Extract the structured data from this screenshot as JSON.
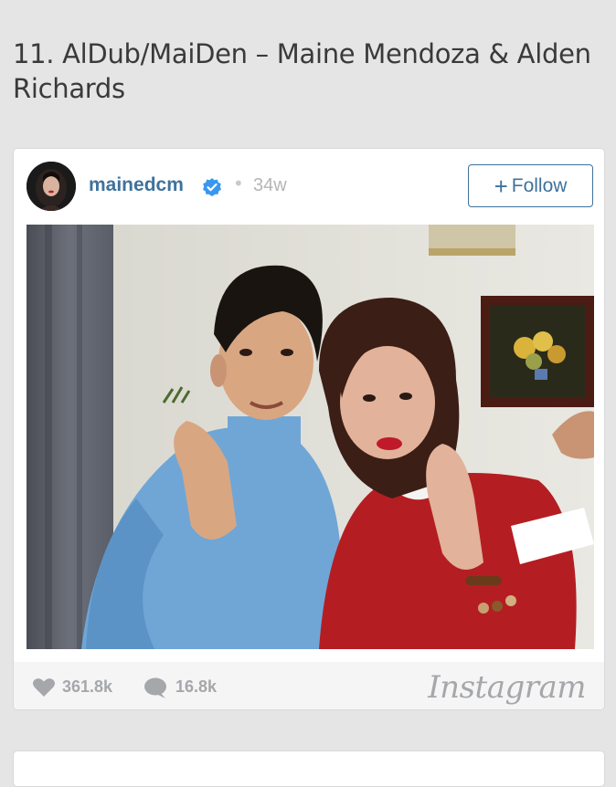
{
  "article": {
    "heading": "11. AlDub/MaiDen – Maine Mendoza & Alden Richards"
  },
  "post": {
    "username": "mainedcm",
    "dot": "•",
    "age": "34w",
    "follow_label": "Follow",
    "follow_plus": "+",
    "likes": "361.8k",
    "comments": "16.8k",
    "brand": "Instagram"
  },
  "colors": {
    "link_blue": "#3f729b",
    "verified_blue": "#3897f0",
    "muted_gray": "#a5a7aa",
    "page_bg": "#e5e5e5"
  },
  "icons": {
    "verified": "verified-badge-icon",
    "like": "heart-icon",
    "comment": "comment-bubble-icon"
  }
}
